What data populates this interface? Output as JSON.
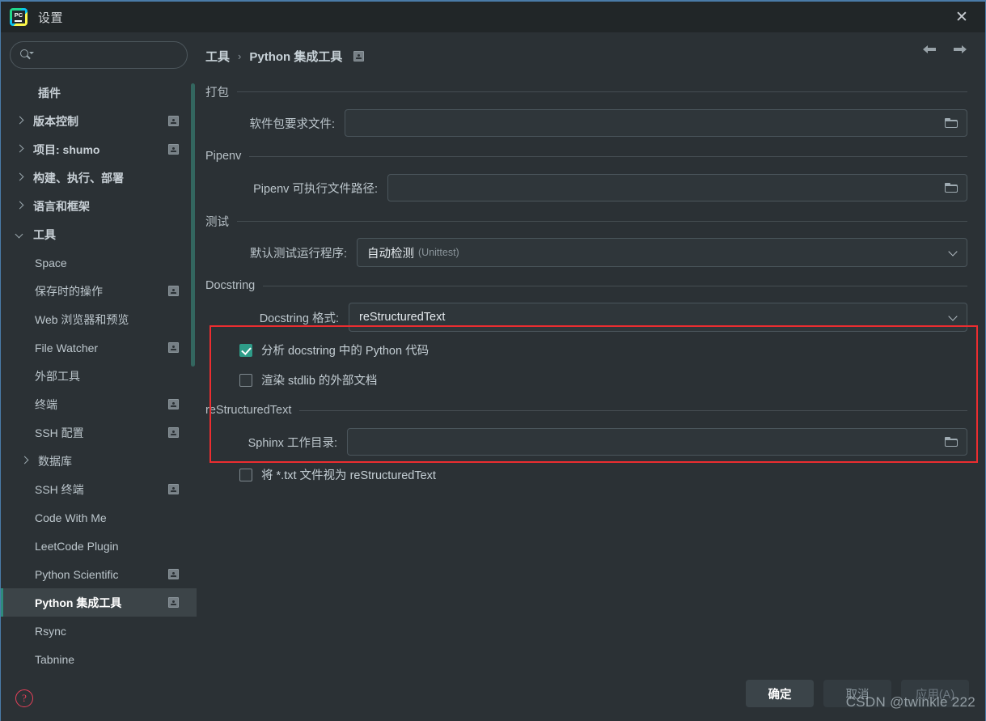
{
  "window": {
    "title": "设置",
    "app_icon": "pycharm-logo-icon",
    "close_label": "✕"
  },
  "sidebar": {
    "search": {
      "placeholder": "",
      "value": "",
      "icon": "search-icon"
    },
    "items": [
      {
        "label": "插件",
        "indent": 1,
        "arrow": "none",
        "badge": false,
        "bold": true,
        "selected": false
      },
      {
        "label": "版本控制",
        "indent": 0,
        "arrow": "right",
        "badge": true,
        "bold": true,
        "selected": false
      },
      {
        "label": "项目: shumo",
        "indent": 0,
        "arrow": "right",
        "badge": true,
        "bold": true,
        "selected": false
      },
      {
        "label": "构建、执行、部署",
        "indent": 0,
        "arrow": "right",
        "badge": false,
        "bold": true,
        "selected": false
      },
      {
        "label": "语言和框架",
        "indent": 0,
        "arrow": "right",
        "badge": false,
        "bold": true,
        "selected": false
      },
      {
        "label": "工具",
        "indent": 0,
        "arrow": "down",
        "badge": false,
        "bold": true,
        "selected": false
      },
      {
        "label": "Space",
        "indent": 2,
        "arrow": "none",
        "badge": false,
        "bold": false,
        "selected": false
      },
      {
        "label": "保存时的操作",
        "indent": 2,
        "arrow": "none",
        "badge": true,
        "bold": false,
        "selected": false
      },
      {
        "label": "Web 浏览器和预览",
        "indent": 2,
        "arrow": "none",
        "badge": false,
        "bold": false,
        "selected": false
      },
      {
        "label": "File Watcher",
        "indent": 2,
        "arrow": "none",
        "badge": true,
        "bold": false,
        "selected": false
      },
      {
        "label": "外部工具",
        "indent": 2,
        "arrow": "none",
        "badge": false,
        "bold": false,
        "selected": false
      },
      {
        "label": "终端",
        "indent": 2,
        "arrow": "none",
        "badge": true,
        "bold": false,
        "selected": false
      },
      {
        "label": "SSH 配置",
        "indent": 2,
        "arrow": "none",
        "badge": true,
        "bold": false,
        "selected": false
      },
      {
        "label": "数据库",
        "indent": 1,
        "arrow": "right",
        "badge": false,
        "bold": false,
        "selected": false
      },
      {
        "label": "SSH 终端",
        "indent": 2,
        "arrow": "none",
        "badge": true,
        "bold": false,
        "selected": false
      },
      {
        "label": "Code With Me",
        "indent": 2,
        "arrow": "none",
        "badge": false,
        "bold": false,
        "selected": false
      },
      {
        "label": "LeetCode Plugin",
        "indent": 2,
        "arrow": "none",
        "badge": false,
        "bold": false,
        "selected": false
      },
      {
        "label": "Python Scientific",
        "indent": 2,
        "arrow": "none",
        "badge": true,
        "bold": false,
        "selected": false
      },
      {
        "label": "Python 集成工具",
        "indent": 2,
        "arrow": "none",
        "badge": true,
        "bold": false,
        "selected": true
      },
      {
        "label": "Rsync",
        "indent": 2,
        "arrow": "none",
        "badge": false,
        "bold": false,
        "selected": false
      },
      {
        "label": "Tabnine",
        "indent": 2,
        "arrow": "none",
        "badge": false,
        "bold": false,
        "selected": false
      }
    ],
    "help_label": "?"
  },
  "breadcrumb": {
    "root": "工具",
    "separator": "›",
    "current": "Python 集成工具",
    "badge": "project-scope-badge-icon",
    "back_icon": "arrow-left-icon",
    "forward_icon": "arrow-right-icon"
  },
  "sections": {
    "packaging": {
      "title": "打包",
      "requirements_label": "软件包要求文件:",
      "requirements_value": ""
    },
    "pipenv": {
      "title": "Pipenv",
      "executable_label": "Pipenv 可执行文件路径:",
      "executable_value": ""
    },
    "testing": {
      "title": "测试",
      "runner_label": "默认测试运行程序:",
      "runner_value": "自动检测",
      "runner_value_sub": "(Unittest)"
    },
    "docstring": {
      "title": "Docstring",
      "format_label": "Docstring 格式:",
      "format_value": "reStructuredText",
      "analyze_label": "分析 docstring 中的 Python 代码",
      "analyze_checked": true,
      "render_label": "渲染 stdlib 的外部文档",
      "render_checked": false
    },
    "restructuredtext": {
      "title": "reStructuredText",
      "sphinx_label": "Sphinx 工作目录:",
      "sphinx_value": "",
      "treat_txt_label": "将 *.txt 文件视为 reStructuredText",
      "treat_txt_checked": false
    }
  },
  "footer": {
    "ok": "确定",
    "cancel": "取消",
    "apply": "应用(A)"
  },
  "watermark": "CSDN @twinkle 222",
  "colors": {
    "background": "#2b3135",
    "titlebar": "#212628",
    "accent_teal": "#2e9c88",
    "annotation_red": "#ec2d30",
    "selected_row": "#3c4448"
  }
}
